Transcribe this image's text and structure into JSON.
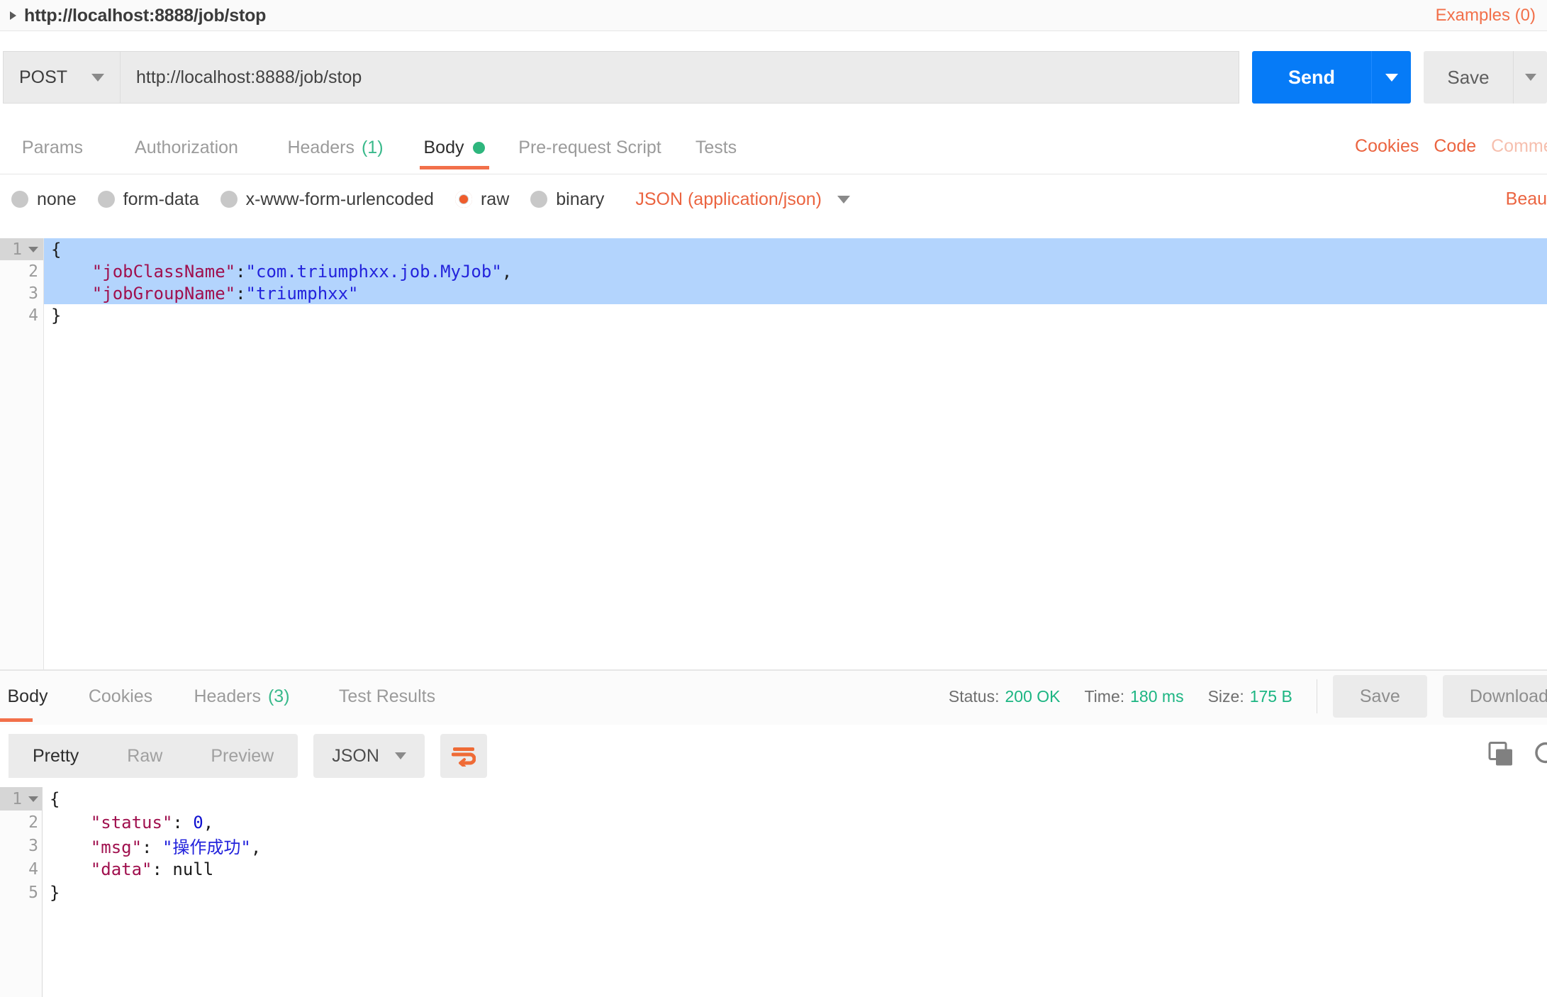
{
  "request_name_bar": {
    "expand_icon": "caret-right-icon",
    "title": "http://localhost:8888/job/stop",
    "examples_link": "Examples (0)"
  },
  "url_bar": {
    "method": "POST",
    "method_caret": "chevron-down-icon",
    "url_value": "http://localhost:8888/job/stop",
    "send_label": "Send",
    "send_caret": "chevron-down-icon",
    "save_label": "Save",
    "save_caret": "chevron-down-icon"
  },
  "request_tabs": {
    "items": [
      {
        "label": "Params",
        "count": "",
        "active": false,
        "dot": false
      },
      {
        "label": "Authorization",
        "count": "",
        "active": false,
        "dot": false
      },
      {
        "label": "Headers",
        "count": "(1)",
        "active": false,
        "dot": false
      },
      {
        "label": "Body",
        "count": "",
        "active": true,
        "dot": true
      },
      {
        "label": "Pre-request Script",
        "count": "",
        "active": false,
        "dot": false
      },
      {
        "label": "Tests",
        "count": "",
        "active": false,
        "dot": false
      }
    ],
    "right_links": [
      {
        "label": "Cookies",
        "muted": false
      },
      {
        "label": "Code",
        "muted": false
      },
      {
        "label": "Comments",
        "muted": true
      }
    ]
  },
  "body_type_row": {
    "options": [
      {
        "label": "none",
        "selected": false
      },
      {
        "label": "form-data",
        "selected": false
      },
      {
        "label": "x-www-form-urlencoded",
        "selected": false
      },
      {
        "label": "raw",
        "selected": true
      },
      {
        "label": "binary",
        "selected": false
      }
    ],
    "content_type": "JSON (application/json)",
    "content_type_caret": "chevron-down-icon",
    "beautify_label": "Beautify"
  },
  "request_body_editor": {
    "active_line": 1,
    "lines": [
      {
        "num": "1",
        "foldable": true,
        "selected": true,
        "tokens": [
          {
            "t": "{",
            "c": "k-punct"
          }
        ]
      },
      {
        "num": "2",
        "foldable": false,
        "selected": true,
        "tokens": [
          {
            "t": "    \"jobClassName\"",
            "c": "k-key"
          },
          {
            "t": ":",
            "c": "k-punct"
          },
          {
            "t": "\"com.triumphxx.job.MyJob\"",
            "c": "k-str"
          },
          {
            "t": ",",
            "c": "k-punct"
          }
        ]
      },
      {
        "num": "3",
        "foldable": false,
        "selected": true,
        "tokens": [
          {
            "t": "    \"jobGroupName\"",
            "c": "k-key"
          },
          {
            "t": ":",
            "c": "k-punct"
          },
          {
            "t": "\"triumphxx\"",
            "c": "k-str"
          }
        ]
      },
      {
        "num": "4",
        "foldable": false,
        "selected": false,
        "tokens": [
          {
            "t": "}",
            "c": "k-punct"
          }
        ]
      }
    ]
  },
  "response_tabs": {
    "items": [
      {
        "label": "Body",
        "count": "",
        "active": true
      },
      {
        "label": "Cookies",
        "count": "",
        "active": false
      },
      {
        "label": "Headers",
        "count": "(3)",
        "active": false
      },
      {
        "label": "Test Results",
        "count": "",
        "active": false
      }
    ],
    "status": [
      {
        "label": "Status:",
        "value": "200 OK"
      },
      {
        "label": "Time:",
        "value": "180 ms"
      },
      {
        "label": "Size:",
        "value": "175 B"
      }
    ],
    "save_label": "Save",
    "download_label": "Download"
  },
  "response_toolbar": {
    "views": [
      {
        "label": "Pretty",
        "active": true
      },
      {
        "label": "Raw",
        "active": false
      },
      {
        "label": "Preview",
        "active": false
      }
    ],
    "format": "JSON",
    "format_caret": "chevron-down-icon",
    "wrap_icon": "word-wrap-icon",
    "copy_icon": "copy-icon",
    "search_icon": "search-icon"
  },
  "response_body_editor": {
    "active_line": 1,
    "lines": [
      {
        "num": "1",
        "foldable": true,
        "active": true,
        "tokens": [
          {
            "t": "{",
            "c": "k-punct"
          }
        ]
      },
      {
        "num": "2",
        "foldable": false,
        "active": false,
        "tokens": [
          {
            "t": "    \"status\"",
            "c": "k-key2"
          },
          {
            "t": ": ",
            "c": "k-punct"
          },
          {
            "t": "0",
            "c": "k-num"
          },
          {
            "t": ",",
            "c": "k-punct"
          }
        ]
      },
      {
        "num": "3",
        "foldable": false,
        "active": false,
        "tokens": [
          {
            "t": "    \"msg\"",
            "c": "k-key2"
          },
          {
            "t": ": ",
            "c": "k-punct"
          },
          {
            "t": "\"操作成功\"",
            "c": "k-str"
          },
          {
            "t": ",",
            "c": "k-punct"
          }
        ]
      },
      {
        "num": "4",
        "foldable": false,
        "active": false,
        "tokens": [
          {
            "t": "    \"data\"",
            "c": "k-key2"
          },
          {
            "t": ": ",
            "c": "k-punct"
          },
          {
            "t": "null",
            "c": "k-null"
          }
        ]
      },
      {
        "num": "5",
        "foldable": false,
        "active": false,
        "tokens": [
          {
            "t": "}",
            "c": "k-punct"
          }
        ]
      }
    ]
  },
  "colors": {
    "accent_orange": "#eb6440",
    "send_blue": "#067bf7",
    "status_green": "#1cb582",
    "selection_blue": "#b3d4fd",
    "json_key": "#a0104e",
    "json_string": "#2323dc"
  }
}
